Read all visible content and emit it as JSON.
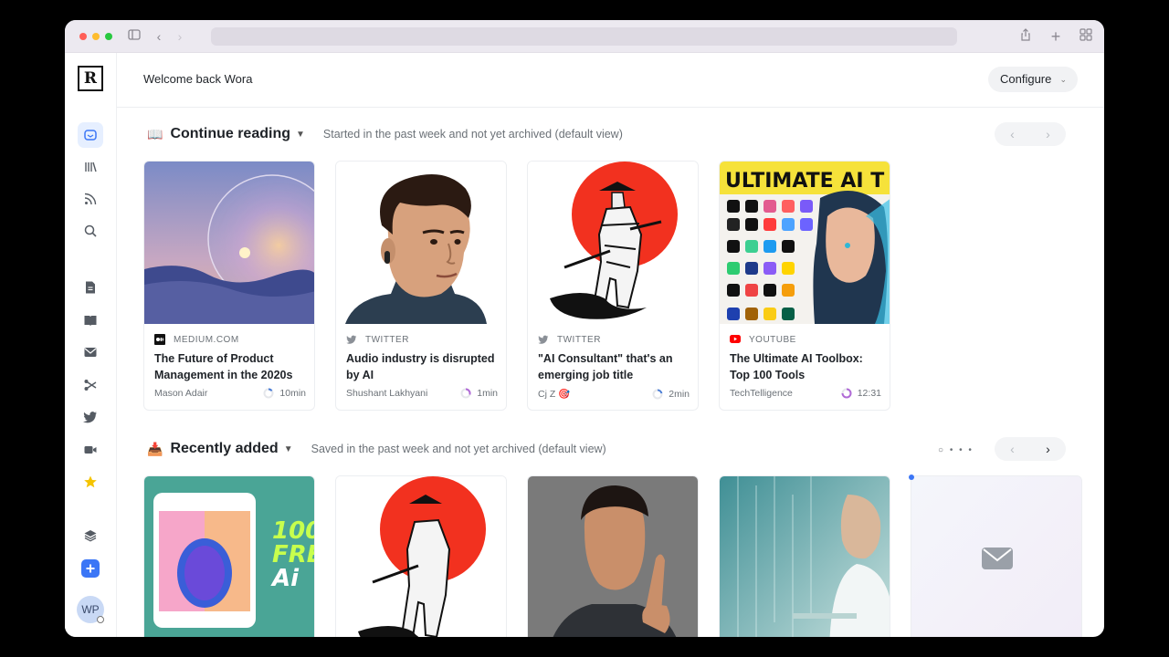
{
  "app": {
    "logo_letter": "R",
    "welcome": "Welcome back Wora",
    "configure_label": "Configure",
    "avatar_initials": "WP"
  },
  "sidebar": {
    "items": [
      {
        "icon": "home-icon",
        "active": true
      },
      {
        "icon": "library-icon"
      },
      {
        "icon": "rss-icon"
      },
      {
        "icon": "search-icon"
      },
      {
        "icon": "document-icon"
      },
      {
        "icon": "book-icon"
      },
      {
        "icon": "mail-icon"
      },
      {
        "icon": "highlight-icon"
      },
      {
        "icon": "twitter-icon"
      },
      {
        "icon": "video-icon"
      },
      {
        "icon": "star-icon"
      },
      {
        "icon": "layers-icon"
      },
      {
        "icon": "add-icon"
      }
    ]
  },
  "continue_reading": {
    "title": "Continue reading",
    "icon": "book-open-icon",
    "subtitle": "Started in the past week and not yet archived (default view)",
    "cards": [
      {
        "source": "MEDIUM.COM",
        "source_icon": "medium-icon",
        "title": "The Future of Product Management in the 2020s",
        "author": "Mason Adair",
        "time": "10min",
        "progress": 0.15
      },
      {
        "source": "TWITTER",
        "source_icon": "twitter-icon",
        "title": "Audio industry is disrupted by AI",
        "author": "Shushant Lakhyani",
        "time": "1min",
        "progress": 0.4
      },
      {
        "source": "TWITTER",
        "source_icon": "twitter-icon",
        "title": "\"AI Consultant\" that's an emerging job title",
        "author": "Cj Z 🎯",
        "time": "2min",
        "progress": 0.3
      },
      {
        "source": "YOUTUBE",
        "source_icon": "youtube-icon",
        "title": "The Ultimate AI Toolbox: Top 100 Tools",
        "author": "TechTelligence",
        "time": "12:31",
        "progress": 0.75
      }
    ]
  },
  "recently_added": {
    "title": "Recently added",
    "icon": "inbox-tray-icon",
    "subtitle": "Saved in the past week and not yet archived (default view)",
    "thumb_text": {
      "line1": "100",
      "line2": "FRE",
      "line3": "Ai"
    }
  },
  "chrome": {
    "banner_text": "ULTIMATE AI T"
  },
  "colors": {
    "accent": "#3b76f6",
    "samurai_sun": "#f2311f"
  }
}
